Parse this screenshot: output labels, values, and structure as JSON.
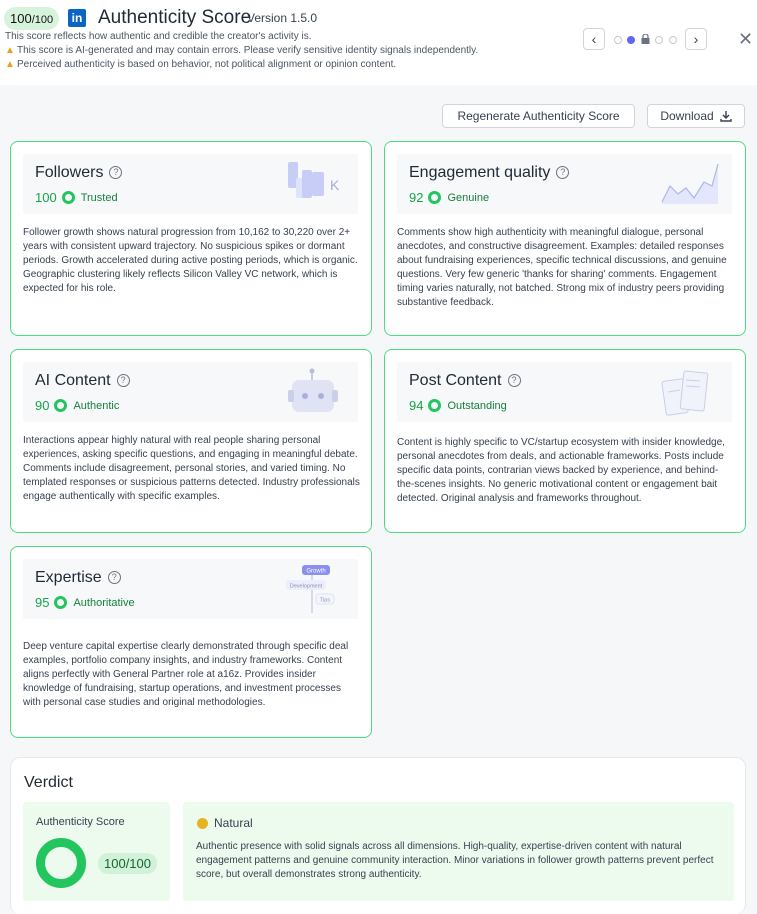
{
  "header": {
    "score_badge": "100",
    "score_badge_max": "/100",
    "title": "Authenticity Score",
    "version": "Version 1.5.0",
    "subtitle": "This score reflects how authentic and credible the creator's activity is.",
    "warnings": [
      "This score is AI-generated and may contain errors. Please verify sensitive identity signals independently.",
      "Perceived authenticity is based on behavior, not political alignment or opinion content."
    ],
    "pager": {
      "prev_icon": "‹",
      "next_icon": "›",
      "close_icon": "✕",
      "active_index": 1
    }
  },
  "actions": {
    "regenerate_label": "Regenerate Authenticity Score",
    "download_label": "Download"
  },
  "cards": [
    {
      "title": "Followers",
      "score": "100",
      "tag": "Trusted",
      "illustration_icon": "follower-bars-icon",
      "text": "Follower growth shows natural progression from 10,162 to 30,220 over 2+ years with consistent upward trajectory. No suspicious spikes or dormant periods. Growth accelerated during active posting periods, which is organic. Geographic clustering likely reflects Silicon Valley VC network, which is expected for his role."
    },
    {
      "title": "Engagement quality",
      "score": "92",
      "tag": "Genuine",
      "illustration_icon": "engagement-chart-icon",
      "text": "Comments show high authenticity with meaningful dialogue, personal anecdotes, and constructive disagreement. Examples: detailed responses about fundraising experiences, specific technical discussions, and genuine questions. Very few generic 'thanks for sharing' comments. Engagement timing varies naturally, not batched. Strong mix of industry peers providing substantive feedback."
    },
    {
      "title": "AI Content",
      "score": "90",
      "tag": "Authentic",
      "illustration_icon": "robot-icon",
      "text": "Interactions appear highly natural with real people sharing personal experiences, asking specific questions, and engaging in meaningful debate. Comments include disagreement, personal stories, and varied timing. No templated responses or suspicious patterns detected. Industry professionals engage authentically with specific examples."
    },
    {
      "title": "Post Content",
      "score": "94",
      "tag": "Outstanding",
      "illustration_icon": "post-cards-icon",
      "text": "Content is highly specific to VC/startup ecosystem with insider knowledge, personal anecdotes from deals, and actionable frameworks. Posts include specific data points, contrarian views backed by experience, and behind-the-scenes insights. No generic motivational content or engagement bait detected. Original analysis and frameworks throughout."
    },
    {
      "title": "Expertise",
      "score": "95",
      "tag": "Authoritative",
      "illustration_icon": "expertise-tree-icon",
      "illus_labels": [
        "Growth",
        "Development",
        "Tips"
      ],
      "text": "Deep venture capital expertise clearly demonstrated through specific deal examples, portfolio company insights, and industry frameworks. Content aligns perfectly with General Partner role at a16z. Provides insider knowledge of fundraising, startup operations, and investment processes with personal case studies and original methodologies."
    }
  ],
  "verdict": {
    "title": "Verdict",
    "score_label": "Authenticity Score",
    "score_value": "100/100",
    "score_fraction": 1.0,
    "badge": "Natural",
    "text": "Authentic presence with solid signals across all dimensions. High-quality, expertise-driven content with natural engagement patterns and genuine community interaction. Minor variations in follower growth patterns prevent perfect score, but overall demonstrates strong authenticity."
  },
  "colors": {
    "accent_green": "#22c55e",
    "card_border": "#4ade80",
    "pager_active": "#6366f1",
    "linkedin": "#0a66c2"
  }
}
